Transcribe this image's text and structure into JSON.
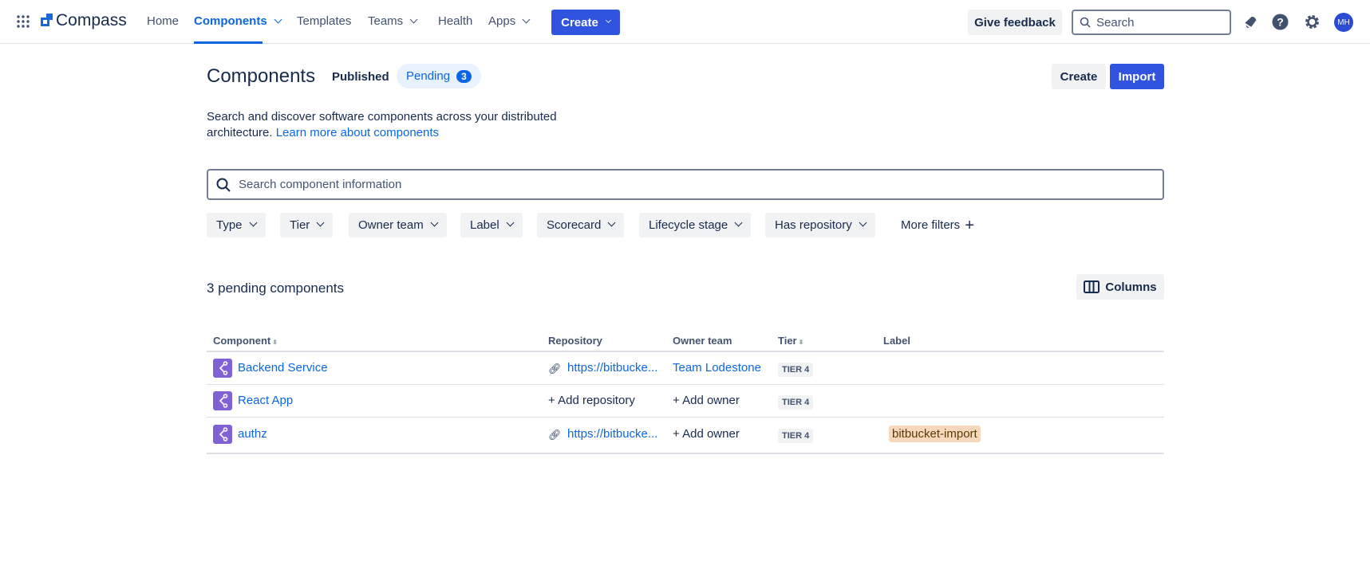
{
  "nav": {
    "logo": "Compass",
    "items": [
      {
        "label": "Home"
      },
      {
        "label": "Components"
      },
      {
        "label": "Templates"
      },
      {
        "label": "Teams"
      },
      {
        "label": "Health"
      },
      {
        "label": "Apps"
      }
    ],
    "create": "Create",
    "feedback": "Give feedback",
    "search_placeholder": "Search",
    "avatar": "MH"
  },
  "page": {
    "title": "Components",
    "tab_published": "Published",
    "tab_pending": "Pending",
    "pending_count": "3",
    "create": "Create",
    "import": "Import",
    "desc": "Search and discover software components across your distributed",
    "desc2": "architecture.",
    "learn_more": "Learn more about components",
    "search_placeholder": "Search component information"
  },
  "filters": [
    "Type",
    "Tier",
    "Owner team",
    "Label",
    "Scorecard",
    "Lifecycle stage",
    "Has repository"
  ],
  "more_filters": "More filters",
  "table": {
    "summary": "3 pending components",
    "columns_btn": "Columns",
    "headers": [
      "Component",
      "Repository",
      "Owner team",
      "Tier",
      "Label"
    ],
    "rows": [
      {
        "name": "Backend Service",
        "repo": "https://bitbucke...",
        "owner": "Team Lodestone",
        "tier": "TIER 4",
        "label": ""
      },
      {
        "name": "React App",
        "repo": "+ Add repository",
        "owner": "+ Add owner",
        "tier": "TIER 4",
        "label": ""
      },
      {
        "name": "authz",
        "repo": "https://bitbucke...",
        "owner": "+ Add owner",
        "tier": "TIER 4",
        "label": "bitbucket-import"
      }
    ]
  },
  "colors": {
    "accent": "#3053e0",
    "component_icon": "#8062d6",
    "label_bg": "#f8d8bd"
  }
}
